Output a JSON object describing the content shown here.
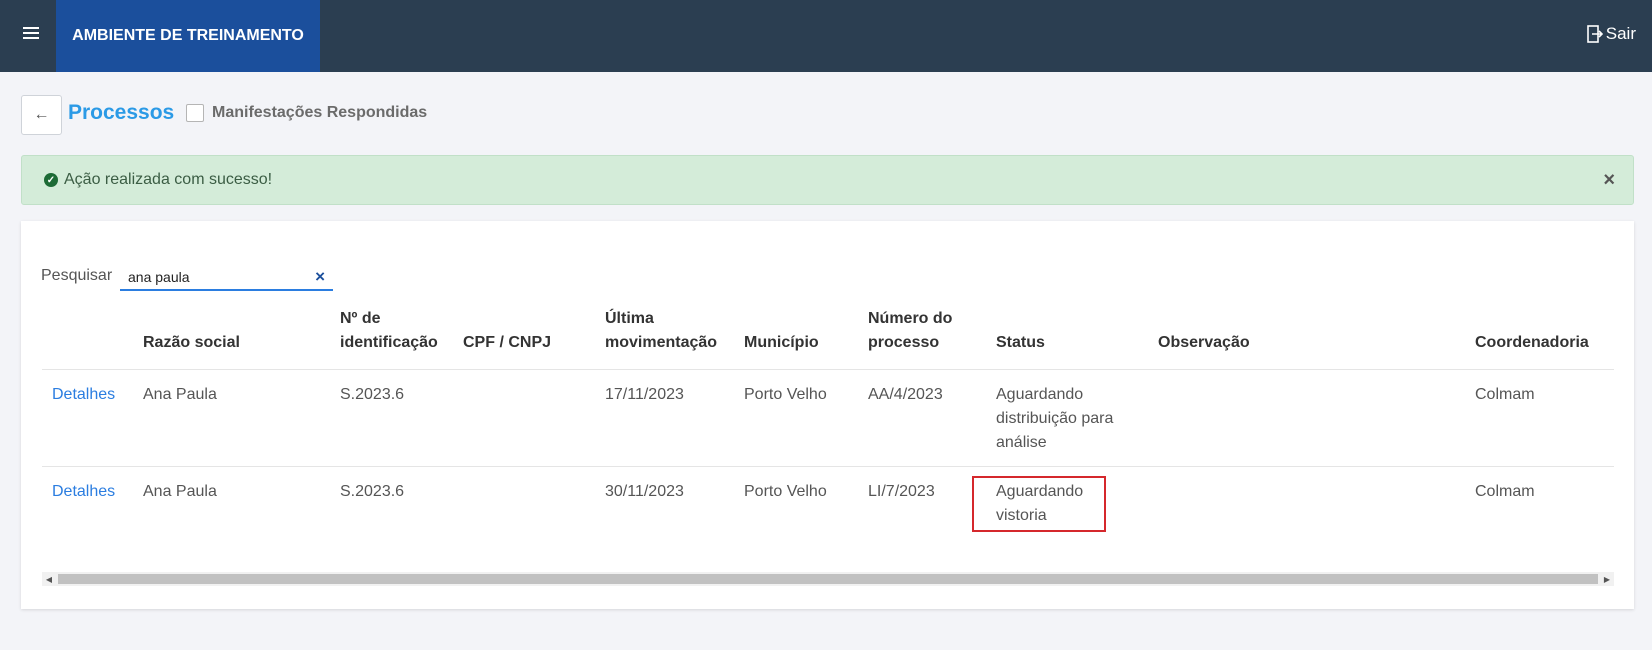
{
  "header": {
    "environment": "AMBIENTE DE TREINAMENTO",
    "logout_label": "Sair"
  },
  "page": {
    "title": "Processos",
    "checkbox_label": "Manifestações Respondidas"
  },
  "alert": {
    "message": "Ação realizada com sucesso!"
  },
  "search": {
    "label": "Pesquisar",
    "value": "ana paula"
  },
  "table": {
    "headers": [
      "",
      "Razão social",
      "Nº de identificação",
      "CPF / CNPJ",
      "Última movimentação",
      "Município",
      "Número do processo",
      "Status",
      "Observação",
      "Coordenadoria"
    ],
    "rows": [
      {
        "action": "Detalhes",
        "razao_social": "Ana Paula",
        "identificacao": "S.2023.6",
        "cpf_cnpj": "",
        "ultima_movimentacao": "17/11/2023",
        "municipio": "Porto Velho",
        "numero_processo": "AA/4/2023",
        "status": "Aguardando distribuição para análise",
        "observacao": "",
        "coordenadoria": "Colmam"
      },
      {
        "action": "Detalhes",
        "razao_social": "Ana Paula",
        "identificacao": "S.2023.6",
        "cpf_cnpj": "",
        "ultima_movimentacao": "30/11/2023",
        "municipio": "Porto Velho",
        "numero_processo": "LI/7/2023",
        "status": "Aguardando vistoria",
        "observacao": "",
        "coordenadoria": "Colmam"
      }
    ]
  },
  "colors": {
    "topbar": "#2b3e51",
    "env_block": "#1b4f9c",
    "title": "#2b9ae6",
    "alert_bg": "#d4ecd9",
    "highlight": "#d5282c"
  }
}
